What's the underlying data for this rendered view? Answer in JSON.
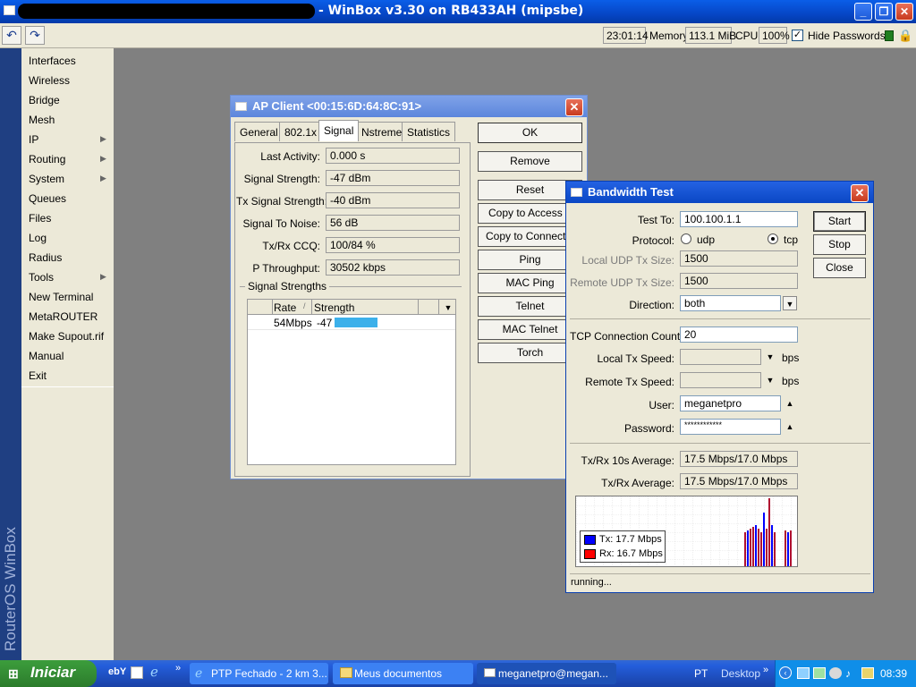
{
  "window": {
    "title": "- WinBox v3.30 on RB433AH (mipsbe)"
  },
  "toolbar": {
    "time": "23:01:14",
    "memory_label": "Memory:",
    "memory_value": "113.1 MiB",
    "cpu_label": "CPU:",
    "cpu_value": "100%",
    "hide_passwords_label": "Hide Passwords",
    "hide_passwords_checked": true
  },
  "sidebar": {
    "brand": "RouterOS WinBox",
    "items": [
      {
        "label": "Interfaces",
        "submenu": false
      },
      {
        "label": "Wireless",
        "submenu": false
      },
      {
        "label": "Bridge",
        "submenu": false
      },
      {
        "label": "Mesh",
        "submenu": false
      },
      {
        "label": "IP",
        "submenu": true
      },
      {
        "label": "Routing",
        "submenu": true
      },
      {
        "label": "System",
        "submenu": true
      },
      {
        "label": "Queues",
        "submenu": false
      },
      {
        "label": "Files",
        "submenu": false
      },
      {
        "label": "Log",
        "submenu": false
      },
      {
        "label": "Radius",
        "submenu": false
      },
      {
        "label": "Tools",
        "submenu": true
      },
      {
        "label": "New Terminal",
        "submenu": false
      },
      {
        "label": "MetaROUTER",
        "submenu": false
      },
      {
        "label": "Make Supout.rif",
        "submenu": false
      },
      {
        "label": "Manual",
        "submenu": false
      },
      {
        "label": "Exit",
        "submenu": false
      }
    ]
  },
  "ap_client": {
    "title": "AP Client <00:15:6D:64:8C:91>",
    "tabs": [
      "General",
      "802.1x",
      "Signal",
      "Nstreme",
      "Statistics"
    ],
    "selected_tab": "Signal",
    "fields": [
      {
        "label": "Last Activity:",
        "value": "0.000 s"
      },
      {
        "label": "Signal Strength:",
        "value": "-47 dBm"
      },
      {
        "label": "Tx Signal Strength:",
        "value": "-40 dBm"
      },
      {
        "label": "Signal To Noise:",
        "value": "56 dB"
      },
      {
        "label": "Tx/Rx CCQ:",
        "value": "100/84 %"
      },
      {
        "label": "P Throughput:",
        "value": "30502 kbps"
      }
    ],
    "group_label": "Signal Strengths",
    "table": {
      "headers": [
        "Rate",
        "Strength"
      ],
      "rows": [
        {
          "rate": "54Mbps",
          "strength": "-47",
          "strength_fill": 0.53
        }
      ]
    },
    "buttons": [
      "OK",
      "Remove",
      "Reset",
      "Copy to Access List",
      "Copy to Connect List",
      "Ping",
      "MAC Ping",
      "Telnet",
      "MAC Telnet",
      "Torch"
    ]
  },
  "bandwidth_test": {
    "title": "Bandwidth Test",
    "test_to_label": "Test To:",
    "test_to": "100.100.1.1",
    "protocol_label": "Protocol:",
    "protocol_options": [
      "udp",
      "tcp"
    ],
    "protocol_selected": "tcp",
    "local_udp_label": "Local UDP Tx Size:",
    "local_udp": "1500",
    "remote_udp_label": "Remote UDP Tx Size:",
    "remote_udp": "1500",
    "direction_label": "Direction:",
    "direction": "both",
    "tcp_conn_label": "TCP Connection Count:",
    "tcp_conn": "20",
    "local_tx_label": "Local Tx Speed:",
    "remote_tx_label": "Remote Tx Speed:",
    "unit": "bps",
    "user_label": "User:",
    "user": "meganetpro",
    "password_label": "Password:",
    "password": "************",
    "avg10_label": "Tx/Rx 10s Average:",
    "avg10": "17.5 Mbps/17.0 Mbps",
    "avg_label": "Tx/Rx Average:",
    "avg": "17.5 Mbps/17.0 Mbps",
    "legend_tx": "Tx:  17.7 Mbps",
    "legend_rx": "Rx:  16.7 Mbps",
    "tx_color": "#0000ff",
    "rx_color": "#ff0000",
    "buttons": [
      "Start",
      "Stop",
      "Close"
    ],
    "status": "running..."
  },
  "taskbar": {
    "start": "Iniciar",
    "tasks": [
      "PTP Fechado - 2 km 3...",
      "Meus documentos",
      "meganetpro@megan..."
    ],
    "lang": "PT",
    "desktop": "Desktop",
    "clock": "08:39"
  }
}
